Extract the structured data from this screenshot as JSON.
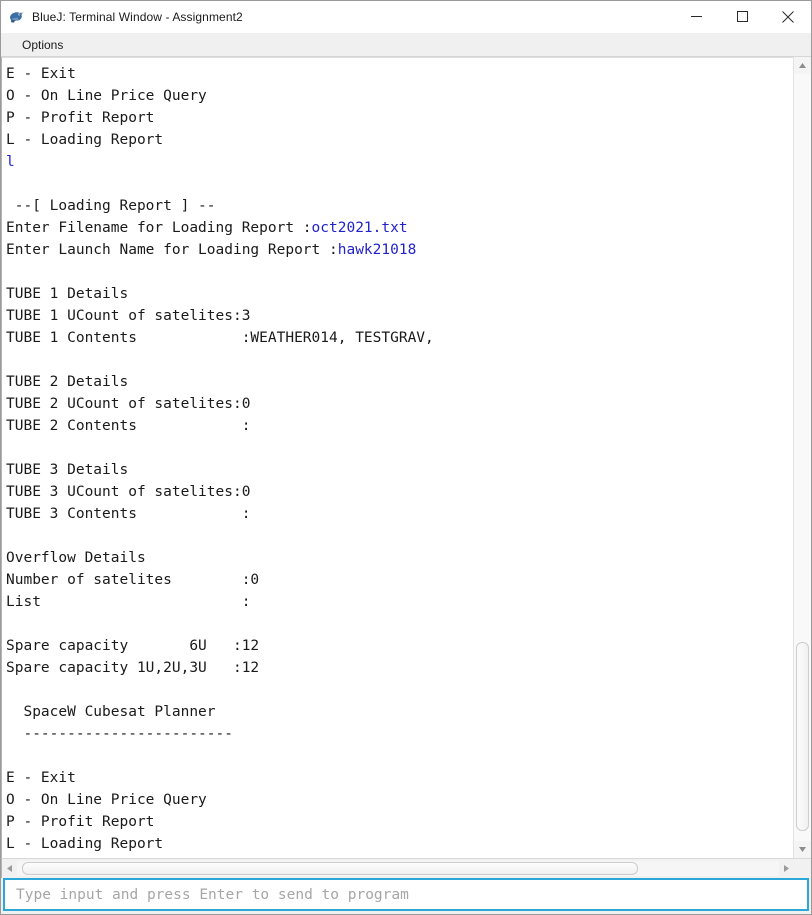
{
  "window": {
    "title": "BlueJ: Terminal Window - Assignment2",
    "app_icon": "bluej-icon",
    "controls": {
      "minimize_label": "—",
      "maximize_label": "□",
      "close_label": "✕"
    }
  },
  "menubar": {
    "items": [
      {
        "label": "Options",
        "name": "menu-options"
      }
    ]
  },
  "terminal": {
    "lines": [
      {
        "text": "E - Exit"
      },
      {
        "text": "O - On Line Price Query"
      },
      {
        "text": "P - Profit Report"
      },
      {
        "text": "L - Loading Report"
      },
      {
        "text": "l",
        "input": true
      },
      {
        "text": ""
      },
      {
        "text": " --[ Loading Report ] --"
      },
      {
        "text": "Enter Filename for Loading Report :",
        "suffix": "oct2021.txt"
      },
      {
        "text": "Enter Launch Name for Loading Report :",
        "suffix": "hawk21018"
      },
      {
        "text": ""
      },
      {
        "text": "TUBE 1 Details"
      },
      {
        "text": "TUBE 1 UCount of satelites:3"
      },
      {
        "text": "TUBE 1 Contents            :WEATHER014, TESTGRAV,"
      },
      {
        "text": ""
      },
      {
        "text": "TUBE 2 Details"
      },
      {
        "text": "TUBE 2 UCount of satelites:0"
      },
      {
        "text": "TUBE 2 Contents            :"
      },
      {
        "text": ""
      },
      {
        "text": "TUBE 3 Details"
      },
      {
        "text": "TUBE 3 UCount of satelites:0"
      },
      {
        "text": "TUBE 3 Contents            :"
      },
      {
        "text": ""
      },
      {
        "text": "Overflow Details"
      },
      {
        "text": "Number of satelites        :0"
      },
      {
        "text": "List                       :"
      },
      {
        "text": ""
      },
      {
        "text": "Spare capacity       6U   :12"
      },
      {
        "text": "Spare capacity 1U,2U,3U   :12"
      },
      {
        "text": ""
      },
      {
        "text": "  SpaceW Cubesat Planner"
      },
      {
        "text": "  ------------------------"
      },
      {
        "text": ""
      },
      {
        "text": "E - Exit"
      },
      {
        "text": "O - On Line Price Query"
      },
      {
        "text": "P - Profit Report"
      },
      {
        "text": "L - Loading Report"
      }
    ]
  },
  "scrollbars": {
    "vertical": {
      "up_arrow": "▲",
      "down_arrow": "▼",
      "thumb_top_pct": 74,
      "thumb_height_pct": 24.5
    },
    "horizontal": {
      "left_arrow": "‹",
      "right_arrow": "›",
      "thumb_left_pct": 0.6,
      "thumb_width_pct": 80.6
    }
  },
  "input": {
    "placeholder": "Type input and press Enter to send to program",
    "value": "",
    "border_color": "#2ca8d8"
  },
  "colors": {
    "user_input_text": "#2222cc",
    "terminal_text": "#1a1a1a",
    "terminal_bg": "#ffffff",
    "chrome_bg": "#f0f0f0"
  }
}
